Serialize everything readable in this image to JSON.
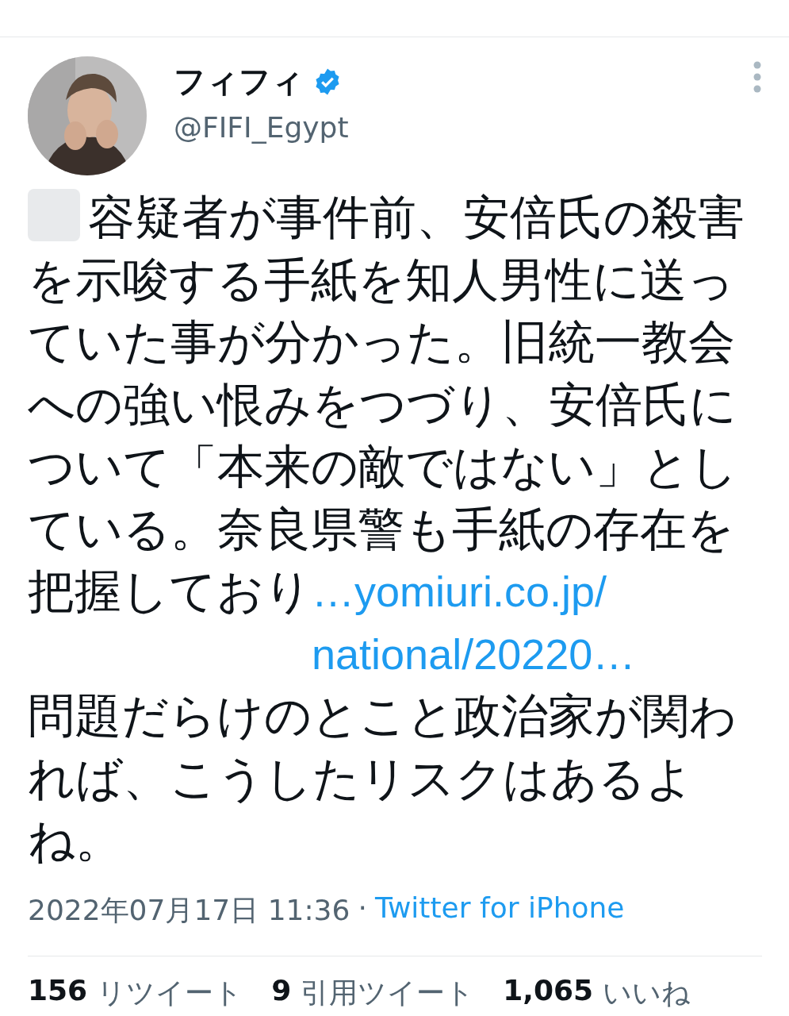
{
  "author": {
    "name": "フィフィ",
    "verified": true,
    "handle": "@FIFI_Egypt"
  },
  "tweet": {
    "text_before": "容疑者が事件前、安倍氏の殺害を示唆する手紙を知人男性に送っていた事が分かった。旧統一教会への強い恨みをつづり、安倍氏について「本来の敵ではない」としている。奈良県警も手紙の存在を把握しており",
    "link": "…yomiuri.co.jp/national/20220…",
    "text_after": "問題だらけのとこと政治家が関われば、こうしたリスクはあるよね。"
  },
  "meta": {
    "timestamp": "2022年07月17日 11:36",
    "separator": "·",
    "source": "Twitter for iPhone"
  },
  "stats": [
    {
      "count": "156",
      "label": "リツイート"
    },
    {
      "count": "9",
      "label": "引用ツイート"
    },
    {
      "count": "1,065",
      "label": "いいね"
    }
  ]
}
